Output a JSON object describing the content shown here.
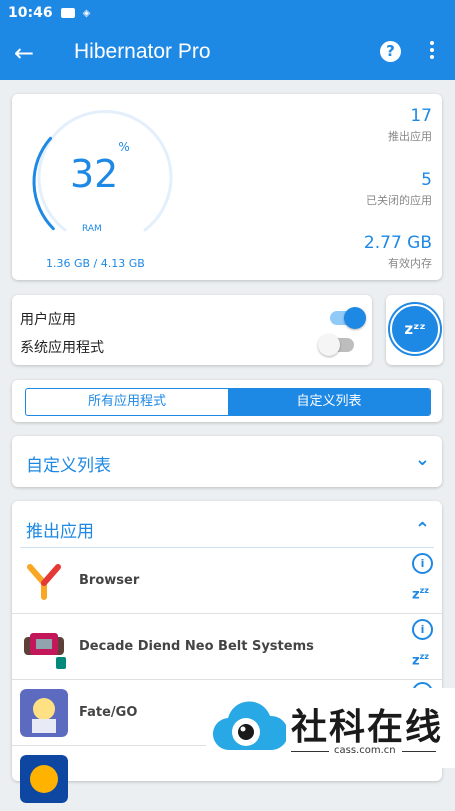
{
  "status_bar": {
    "time": "10:46"
  },
  "app_bar": {
    "title": "Hibernator Pro",
    "help_label": "?"
  },
  "ram": {
    "percent": "32",
    "percent_sign": "%",
    "label": "RAM",
    "usage": "1.36 GB / 4.13 GB",
    "gauge_fraction": 0.32
  },
  "stats": [
    {
      "value": "17",
      "label": "推出应用"
    },
    {
      "value": "5",
      "label": "已关闭的应用"
    },
    {
      "value": "2.77 GB",
      "label": "有效内存"
    }
  ],
  "toggles": {
    "user_apps": {
      "label": "用户应用",
      "on": true
    },
    "system_apps": {
      "label": "系统应用程式",
      "on": false
    }
  },
  "hibernate_button": {
    "label": "zᶻᶻ"
  },
  "tabs": [
    {
      "label": "所有应用程式",
      "active": false
    },
    {
      "label": "自定义列表",
      "active": true
    }
  ],
  "sections": {
    "custom_list": {
      "title": "自定义列表"
    },
    "running": {
      "title": "推出应用"
    }
  },
  "apps": [
    {
      "name": "Browser"
    },
    {
      "name": "Decade Diend Neo Belt Systems"
    },
    {
      "name": "Fate/GO"
    }
  ],
  "watermark": {
    "text": "社科在线",
    "domain": "cass.com.cn"
  },
  "colors": {
    "primary": "#1e88e5",
    "background": "#eceff1"
  }
}
